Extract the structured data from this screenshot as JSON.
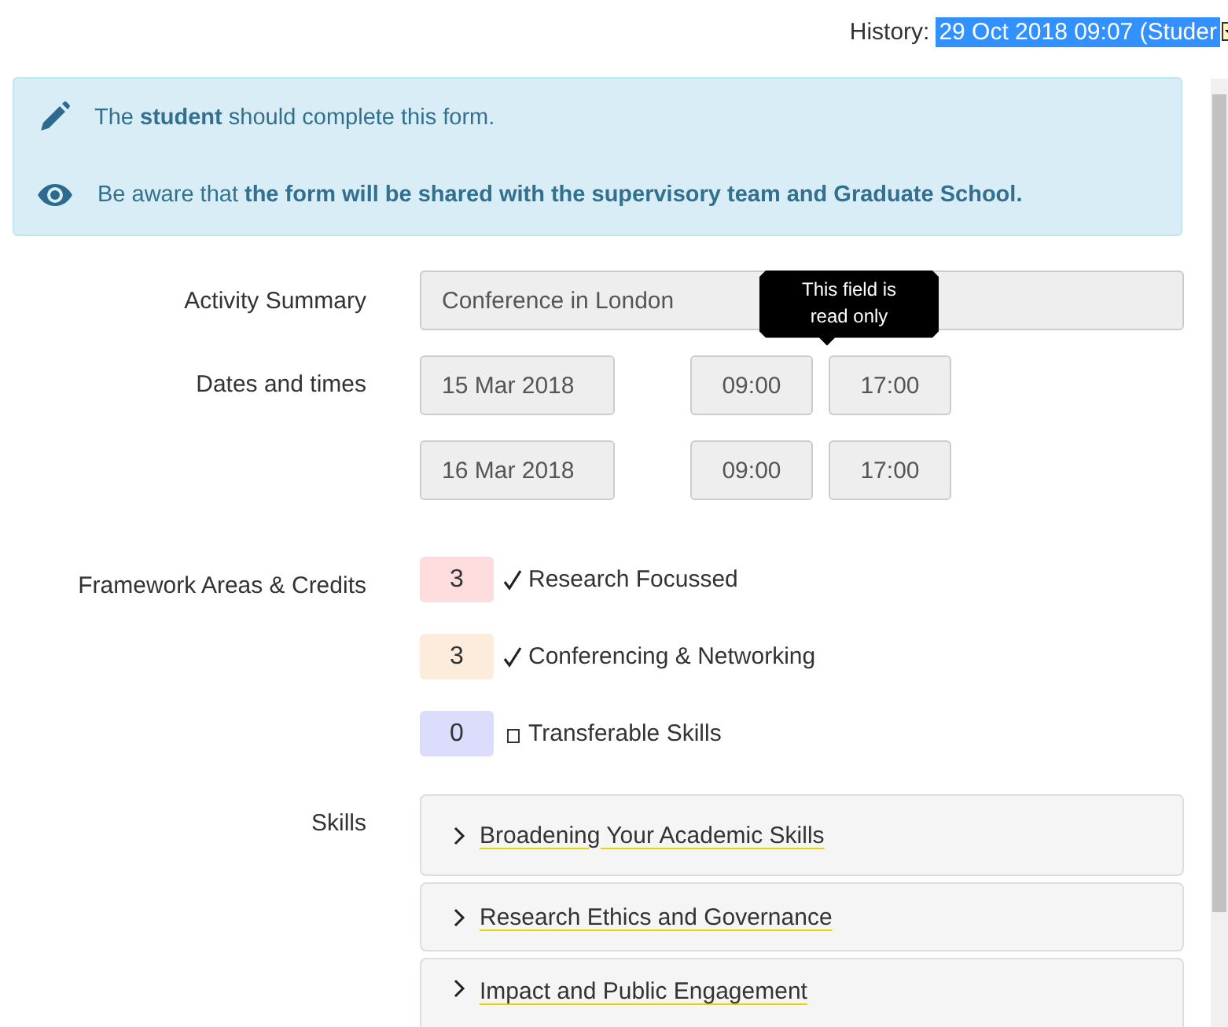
{
  "history": {
    "label": "History:",
    "value": "29 Oct 2018 09:07 (Studer"
  },
  "notices": [
    {
      "kind": "pencil",
      "text": "The **student** should complete this form."
    },
    {
      "kind": "eye",
      "text": "Be aware that **the form will be shared with the supervisory team and Graduate School.**"
    }
  ],
  "activity_summary": {
    "label": "Activity Summary",
    "value": "Conference in London",
    "tooltip": "This field is read only"
  },
  "dates": {
    "label": "Dates and times",
    "rows": [
      {
        "date": "15 Mar 2018",
        "start": "09:00",
        "end": "17:00"
      },
      {
        "date": "16 Mar 2018",
        "start": "09:00",
        "end": "17:00"
      }
    ]
  },
  "framework": {
    "label": "Framework Areas & Credits",
    "items": [
      {
        "credits": "3",
        "checked": true,
        "name": "Research Focussed",
        "color": "#fcdcdc"
      },
      {
        "credits": "3",
        "checked": true,
        "name": "Conferencing & Networking",
        "color": "#fdebdc"
      },
      {
        "credits": "0",
        "checked": false,
        "name": "Transferable Skills",
        "color": "#dcdcfc"
      }
    ]
  },
  "skills": {
    "label": "Skills",
    "items": [
      {
        "title": "Broadening Your Academic Skills",
        "expanded": false
      },
      {
        "title": "Research Ethics and Governance",
        "expanded": false
      },
      {
        "title": "Impact and Public Engagement",
        "expanded": false
      }
    ]
  }
}
